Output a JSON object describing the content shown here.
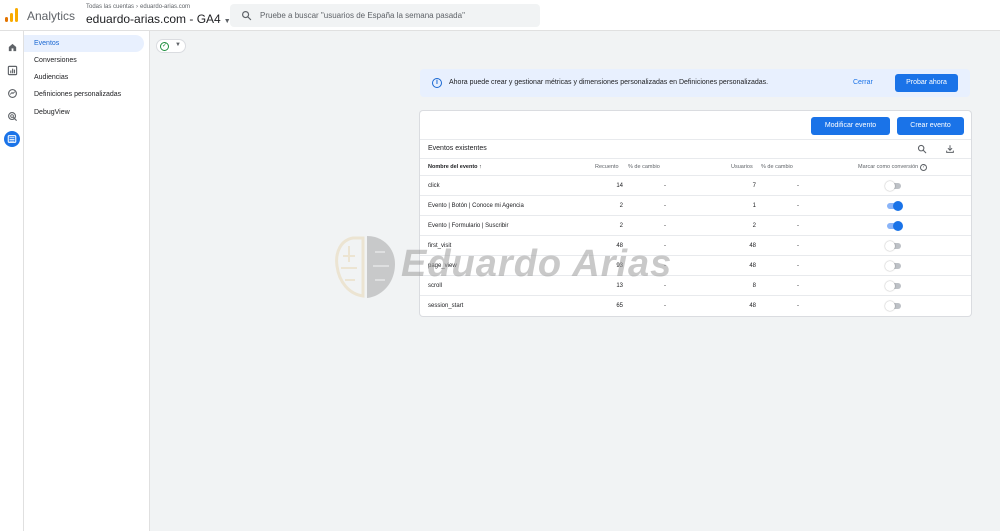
{
  "header": {
    "app_title": "Analytics",
    "breadcrumb": [
      "Todas las cuentas",
      "eduardo-arias.com"
    ],
    "property_name": "eduardo-arias.com - GA4",
    "search_placeholder": "Pruebe a buscar \"usuarios de España la semana pasada\""
  },
  "rail": {
    "icons": [
      "home-icon",
      "reports-icon",
      "explore-icon",
      "advertising-icon",
      "configure-icon"
    ]
  },
  "subnav": {
    "items": [
      {
        "label": "Eventos",
        "active": true
      },
      {
        "label": "Conversiones"
      },
      {
        "label": "Audiencias"
      },
      {
        "label": "Definiciones personalizadas"
      },
      {
        "label": "DebugView"
      }
    ]
  },
  "banner": {
    "message": "Ahora puede crear y gestionar métricas y dimensiones personalizadas en Definiciones personalizadas.",
    "dismiss_label": "Cerrar",
    "action_label": "Probar ahora"
  },
  "events_card": {
    "modify_label": "Modificar evento",
    "create_label": "Crear evento",
    "title": "Eventos existentes",
    "columns": {
      "name": "Nombre del evento",
      "count": "Recuento",
      "count_change": "% de cambio",
      "users": "Usuarios",
      "users_change": "% de cambio",
      "conversion": "Marcar como conversión"
    },
    "rows": [
      {
        "name": "click",
        "count": "14",
        "count_change": "-",
        "users": "7",
        "users_change": "-",
        "conversion": false
      },
      {
        "name": "Evento | Botón | Conoce mi Agencia",
        "count": "2",
        "count_change": "-",
        "users": "1",
        "users_change": "-",
        "conversion": true
      },
      {
        "name": "Evento | Formulario | Suscribir",
        "count": "2",
        "count_change": "-",
        "users": "2",
        "users_change": "-",
        "conversion": true
      },
      {
        "name": "first_visit",
        "count": "48",
        "count_change": "-",
        "users": "48",
        "users_change": "-",
        "conversion": false
      },
      {
        "name": "page_view",
        "count": "93",
        "count_change": "-",
        "users": "48",
        "users_change": "-",
        "conversion": false
      },
      {
        "name": "scroll",
        "count": "13",
        "count_change": "-",
        "users": "8",
        "users_change": "-",
        "conversion": false
      },
      {
        "name": "session_start",
        "count": "65",
        "count_change": "-",
        "users": "48",
        "users_change": "-",
        "conversion": false
      }
    ]
  },
  "watermark": {
    "text": "Eduardo Arias"
  },
  "colors": {
    "accent": "#1a73e8",
    "active_nav_bg": "#e8f0fe",
    "logo_orange": "#f9ab00",
    "logo_dark_orange": "#e37400",
    "success_green": "#1e8e3e"
  }
}
